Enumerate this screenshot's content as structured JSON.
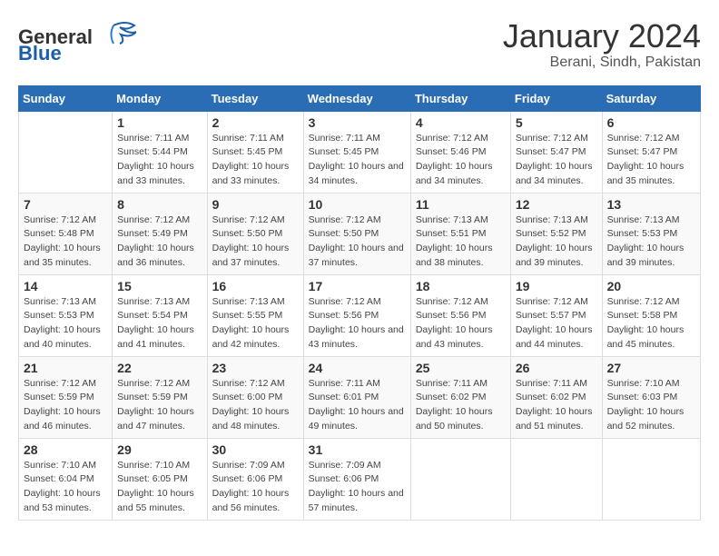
{
  "header": {
    "logo_general": "General",
    "logo_blue": "Blue",
    "title": "January 2024",
    "subtitle": "Berani, Sindh, Pakistan"
  },
  "calendar": {
    "days_of_week": [
      "Sunday",
      "Monday",
      "Tuesday",
      "Wednesday",
      "Thursday",
      "Friday",
      "Saturday"
    ],
    "weeks": [
      [
        {
          "day": "",
          "sunrise": "",
          "sunset": "",
          "daylight": ""
        },
        {
          "day": "1",
          "sunrise": "Sunrise: 7:11 AM",
          "sunset": "Sunset: 5:44 PM",
          "daylight": "Daylight: 10 hours and 33 minutes."
        },
        {
          "day": "2",
          "sunrise": "Sunrise: 7:11 AM",
          "sunset": "Sunset: 5:45 PM",
          "daylight": "Daylight: 10 hours and 33 minutes."
        },
        {
          "day": "3",
          "sunrise": "Sunrise: 7:11 AM",
          "sunset": "Sunset: 5:45 PM",
          "daylight": "Daylight: 10 hours and 34 minutes."
        },
        {
          "day": "4",
          "sunrise": "Sunrise: 7:12 AM",
          "sunset": "Sunset: 5:46 PM",
          "daylight": "Daylight: 10 hours and 34 minutes."
        },
        {
          "day": "5",
          "sunrise": "Sunrise: 7:12 AM",
          "sunset": "Sunset: 5:47 PM",
          "daylight": "Daylight: 10 hours and 34 minutes."
        },
        {
          "day": "6",
          "sunrise": "Sunrise: 7:12 AM",
          "sunset": "Sunset: 5:47 PM",
          "daylight": "Daylight: 10 hours and 35 minutes."
        }
      ],
      [
        {
          "day": "7",
          "sunrise": "Sunrise: 7:12 AM",
          "sunset": "Sunset: 5:48 PM",
          "daylight": "Daylight: 10 hours and 35 minutes."
        },
        {
          "day": "8",
          "sunrise": "Sunrise: 7:12 AM",
          "sunset": "Sunset: 5:49 PM",
          "daylight": "Daylight: 10 hours and 36 minutes."
        },
        {
          "day": "9",
          "sunrise": "Sunrise: 7:12 AM",
          "sunset": "Sunset: 5:50 PM",
          "daylight": "Daylight: 10 hours and 37 minutes."
        },
        {
          "day": "10",
          "sunrise": "Sunrise: 7:12 AM",
          "sunset": "Sunset: 5:50 PM",
          "daylight": "Daylight: 10 hours and 37 minutes."
        },
        {
          "day": "11",
          "sunrise": "Sunrise: 7:13 AM",
          "sunset": "Sunset: 5:51 PM",
          "daylight": "Daylight: 10 hours and 38 minutes."
        },
        {
          "day": "12",
          "sunrise": "Sunrise: 7:13 AM",
          "sunset": "Sunset: 5:52 PM",
          "daylight": "Daylight: 10 hours and 39 minutes."
        },
        {
          "day": "13",
          "sunrise": "Sunrise: 7:13 AM",
          "sunset": "Sunset: 5:53 PM",
          "daylight": "Daylight: 10 hours and 39 minutes."
        }
      ],
      [
        {
          "day": "14",
          "sunrise": "Sunrise: 7:13 AM",
          "sunset": "Sunset: 5:53 PM",
          "daylight": "Daylight: 10 hours and 40 minutes."
        },
        {
          "day": "15",
          "sunrise": "Sunrise: 7:13 AM",
          "sunset": "Sunset: 5:54 PM",
          "daylight": "Daylight: 10 hours and 41 minutes."
        },
        {
          "day": "16",
          "sunrise": "Sunrise: 7:13 AM",
          "sunset": "Sunset: 5:55 PM",
          "daylight": "Daylight: 10 hours and 42 minutes."
        },
        {
          "day": "17",
          "sunrise": "Sunrise: 7:12 AM",
          "sunset": "Sunset: 5:56 PM",
          "daylight": "Daylight: 10 hours and 43 minutes."
        },
        {
          "day": "18",
          "sunrise": "Sunrise: 7:12 AM",
          "sunset": "Sunset: 5:56 PM",
          "daylight": "Daylight: 10 hours and 43 minutes."
        },
        {
          "day": "19",
          "sunrise": "Sunrise: 7:12 AM",
          "sunset": "Sunset: 5:57 PM",
          "daylight": "Daylight: 10 hours and 44 minutes."
        },
        {
          "day": "20",
          "sunrise": "Sunrise: 7:12 AM",
          "sunset": "Sunset: 5:58 PM",
          "daylight": "Daylight: 10 hours and 45 minutes."
        }
      ],
      [
        {
          "day": "21",
          "sunrise": "Sunrise: 7:12 AM",
          "sunset": "Sunset: 5:59 PM",
          "daylight": "Daylight: 10 hours and 46 minutes."
        },
        {
          "day": "22",
          "sunrise": "Sunrise: 7:12 AM",
          "sunset": "Sunset: 5:59 PM",
          "daylight": "Daylight: 10 hours and 47 minutes."
        },
        {
          "day": "23",
          "sunrise": "Sunrise: 7:12 AM",
          "sunset": "Sunset: 6:00 PM",
          "daylight": "Daylight: 10 hours and 48 minutes."
        },
        {
          "day": "24",
          "sunrise": "Sunrise: 7:11 AM",
          "sunset": "Sunset: 6:01 PM",
          "daylight": "Daylight: 10 hours and 49 minutes."
        },
        {
          "day": "25",
          "sunrise": "Sunrise: 7:11 AM",
          "sunset": "Sunset: 6:02 PM",
          "daylight": "Daylight: 10 hours and 50 minutes."
        },
        {
          "day": "26",
          "sunrise": "Sunrise: 7:11 AM",
          "sunset": "Sunset: 6:02 PM",
          "daylight": "Daylight: 10 hours and 51 minutes."
        },
        {
          "day": "27",
          "sunrise": "Sunrise: 7:10 AM",
          "sunset": "Sunset: 6:03 PM",
          "daylight": "Daylight: 10 hours and 52 minutes."
        }
      ],
      [
        {
          "day": "28",
          "sunrise": "Sunrise: 7:10 AM",
          "sunset": "Sunset: 6:04 PM",
          "daylight": "Daylight: 10 hours and 53 minutes."
        },
        {
          "day": "29",
          "sunrise": "Sunrise: 7:10 AM",
          "sunset": "Sunset: 6:05 PM",
          "daylight": "Daylight: 10 hours and 55 minutes."
        },
        {
          "day": "30",
          "sunrise": "Sunrise: 7:09 AM",
          "sunset": "Sunset: 6:06 PM",
          "daylight": "Daylight: 10 hours and 56 minutes."
        },
        {
          "day": "31",
          "sunrise": "Sunrise: 7:09 AM",
          "sunset": "Sunset: 6:06 PM",
          "daylight": "Daylight: 10 hours and 57 minutes."
        },
        {
          "day": "",
          "sunrise": "",
          "sunset": "",
          "daylight": ""
        },
        {
          "day": "",
          "sunrise": "",
          "sunset": "",
          "daylight": ""
        },
        {
          "day": "",
          "sunrise": "",
          "sunset": "",
          "daylight": ""
        }
      ]
    ]
  }
}
